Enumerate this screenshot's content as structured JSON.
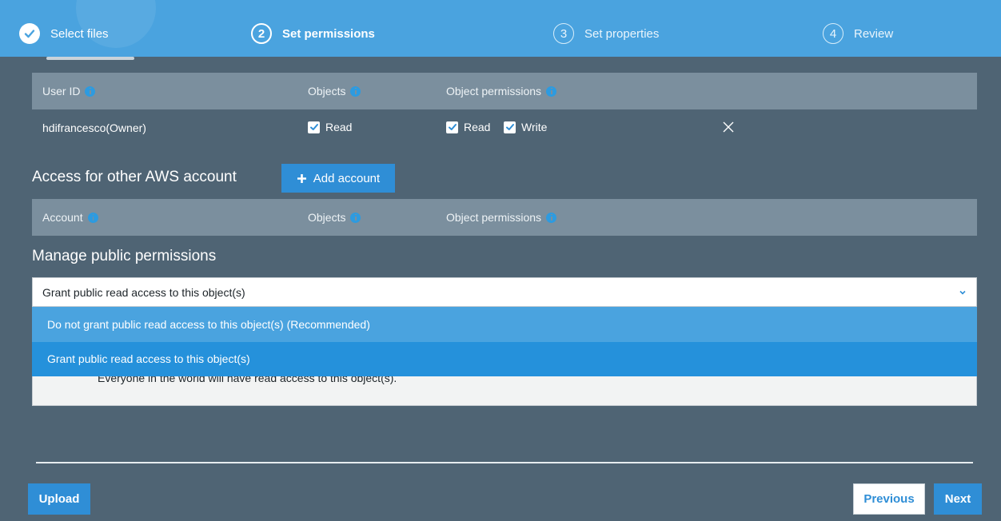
{
  "steps": [
    {
      "number": "1",
      "label": "Select files",
      "state": "done"
    },
    {
      "number": "2",
      "label": "Set permissions",
      "state": "active"
    },
    {
      "number": "3",
      "label": "Set properties",
      "state": "pending"
    },
    {
      "number": "4",
      "label": "Review",
      "state": "pending"
    }
  ],
  "owner_table": {
    "headers": [
      "User ID",
      "Objects",
      "Object permissions"
    ],
    "row": {
      "user": "hdifrancesco(Owner)",
      "objects_read": "Read",
      "perm_read": "Read",
      "perm_write": "Write"
    }
  },
  "other_accounts": {
    "title": "Access for other AWS account",
    "add_button": "Add account",
    "headers": [
      "Account",
      "Objects",
      "Object permissions"
    ]
  },
  "public": {
    "title": "Manage public permissions",
    "selected": "Grant public read access to this object(s)",
    "options": [
      "Do not grant public read access to this object(s) (Recommended)",
      "Grant public read access to this object(s)"
    ],
    "note": "Everyone in the world will have read access to this object(s)."
  },
  "footer": {
    "upload": "Upload",
    "previous": "Previous",
    "next": "Next"
  },
  "colors": {
    "stepper_bg": "#4aa3df",
    "page_bg": "#4f6474",
    "accent": "#2f8ed6"
  }
}
